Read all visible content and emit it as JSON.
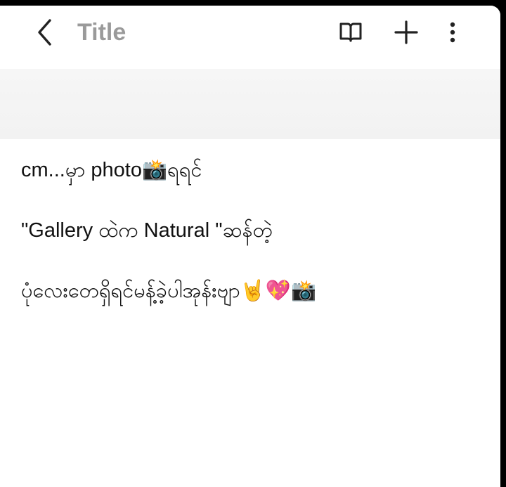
{
  "app_bar": {
    "title": "Title",
    "back_icon": "chevron-left-icon",
    "reader_icon": "book-open-icon",
    "add_icon": "plus-icon",
    "more_icon": "more-vertical-icon"
  },
  "note": {
    "lines": [
      "cm...မှာ photo📸ရရင်",
      "\"Gallery ထဲက Natural \"ဆန်တဲ့",
      "ပုံလေးတေရှိရင်မန့်ခဲ့ပါအုန်းဗျာ🤘💖📸"
    ]
  },
  "colors": {
    "title_gray": "#9a9a9a",
    "band_gray": "#f4f4f4",
    "text": "#111111",
    "icon": "#222222"
  }
}
